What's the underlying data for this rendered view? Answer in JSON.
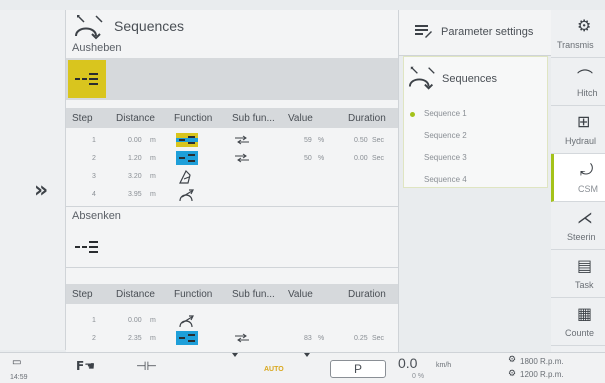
{
  "main": {
    "title": "Sequences",
    "section_raise": "Ausheben",
    "section_lower": "Absenken",
    "columns": [
      "Step",
      "Distance",
      "Function",
      "Sub fun...",
      "Value",
      "Duration"
    ],
    "columns_lower": [
      "Step",
      "Distance",
      "Function",
      "Sub fun...",
      "Value",
      "Duration"
    ],
    "raise_rows": [
      {
        "step": "1",
        "distance": "0.00",
        "unit": "m",
        "function": "hitch-blue-yellow",
        "sub": "arrows",
        "value": "59",
        "value_unit": "%",
        "duration": "0.50",
        "duration_unit": "Sec"
      },
      {
        "step": "2",
        "distance": "1.20",
        "unit": "m",
        "function": "hitch-blue",
        "sub": "arrows",
        "value": "50",
        "value_unit": "%",
        "duration": "0.00",
        "duration_unit": "Sec"
      },
      {
        "step": "3",
        "distance": "3.20",
        "unit": "m",
        "function": "pto",
        "sub": "",
        "value": "",
        "value_unit": "",
        "duration": "",
        "duration_unit": ""
      },
      {
        "step": "4",
        "distance": "3.95",
        "unit": "m",
        "function": "csm",
        "sub": "",
        "value": "",
        "value_unit": "",
        "duration": "",
        "duration_unit": ""
      }
    ],
    "lower_rows": [
      {
        "step": "1",
        "distance": "0.00",
        "unit": "m",
        "function": "csm",
        "sub": "",
        "value": "",
        "value_unit": "",
        "duration": "",
        "duration_unit": ""
      },
      {
        "step": "2",
        "distance": "2.35",
        "unit": "m",
        "function": "hitch-blue",
        "sub": "arrows",
        "value": "83",
        "value_unit": "%",
        "duration": "0.25",
        "duration_unit": "Sec"
      }
    ]
  },
  "middle": {
    "param_label": "Parameter settings",
    "seq_title": "Sequences",
    "sequences": [
      "Sequence 1",
      "Sequence 2",
      "Sequence 3",
      "Sequence 4"
    ],
    "active_index": 0
  },
  "right": {
    "items": [
      {
        "label": "Transmis",
        "icon": "transmission-icon"
      },
      {
        "label": "Hitch",
        "icon": "hitch-icon"
      },
      {
        "label": "Hydraul",
        "icon": "hydraulic-icon"
      },
      {
        "label": "CSM",
        "icon": "csm-icon"
      },
      {
        "label": "Steerin",
        "icon": "steering-icon"
      },
      {
        "label": "Task",
        "icon": "task-icon"
      },
      {
        "label": "Counte",
        "icon": "counter-icon"
      }
    ],
    "active": "CSM"
  },
  "bottom": {
    "time": "14:59",
    "auto": "AUTO",
    "park": "P",
    "speed": "0.0",
    "speed_unit": "km/h",
    "slip": "0 %",
    "rpm1": "1800 R.p.m.",
    "rpm2": "1200 R.p.m."
  },
  "colors": {
    "accent": "#a4c21a",
    "yellow": "#d9c51e",
    "blue": "#1e9fd9",
    "auto": "#d9a81e"
  }
}
